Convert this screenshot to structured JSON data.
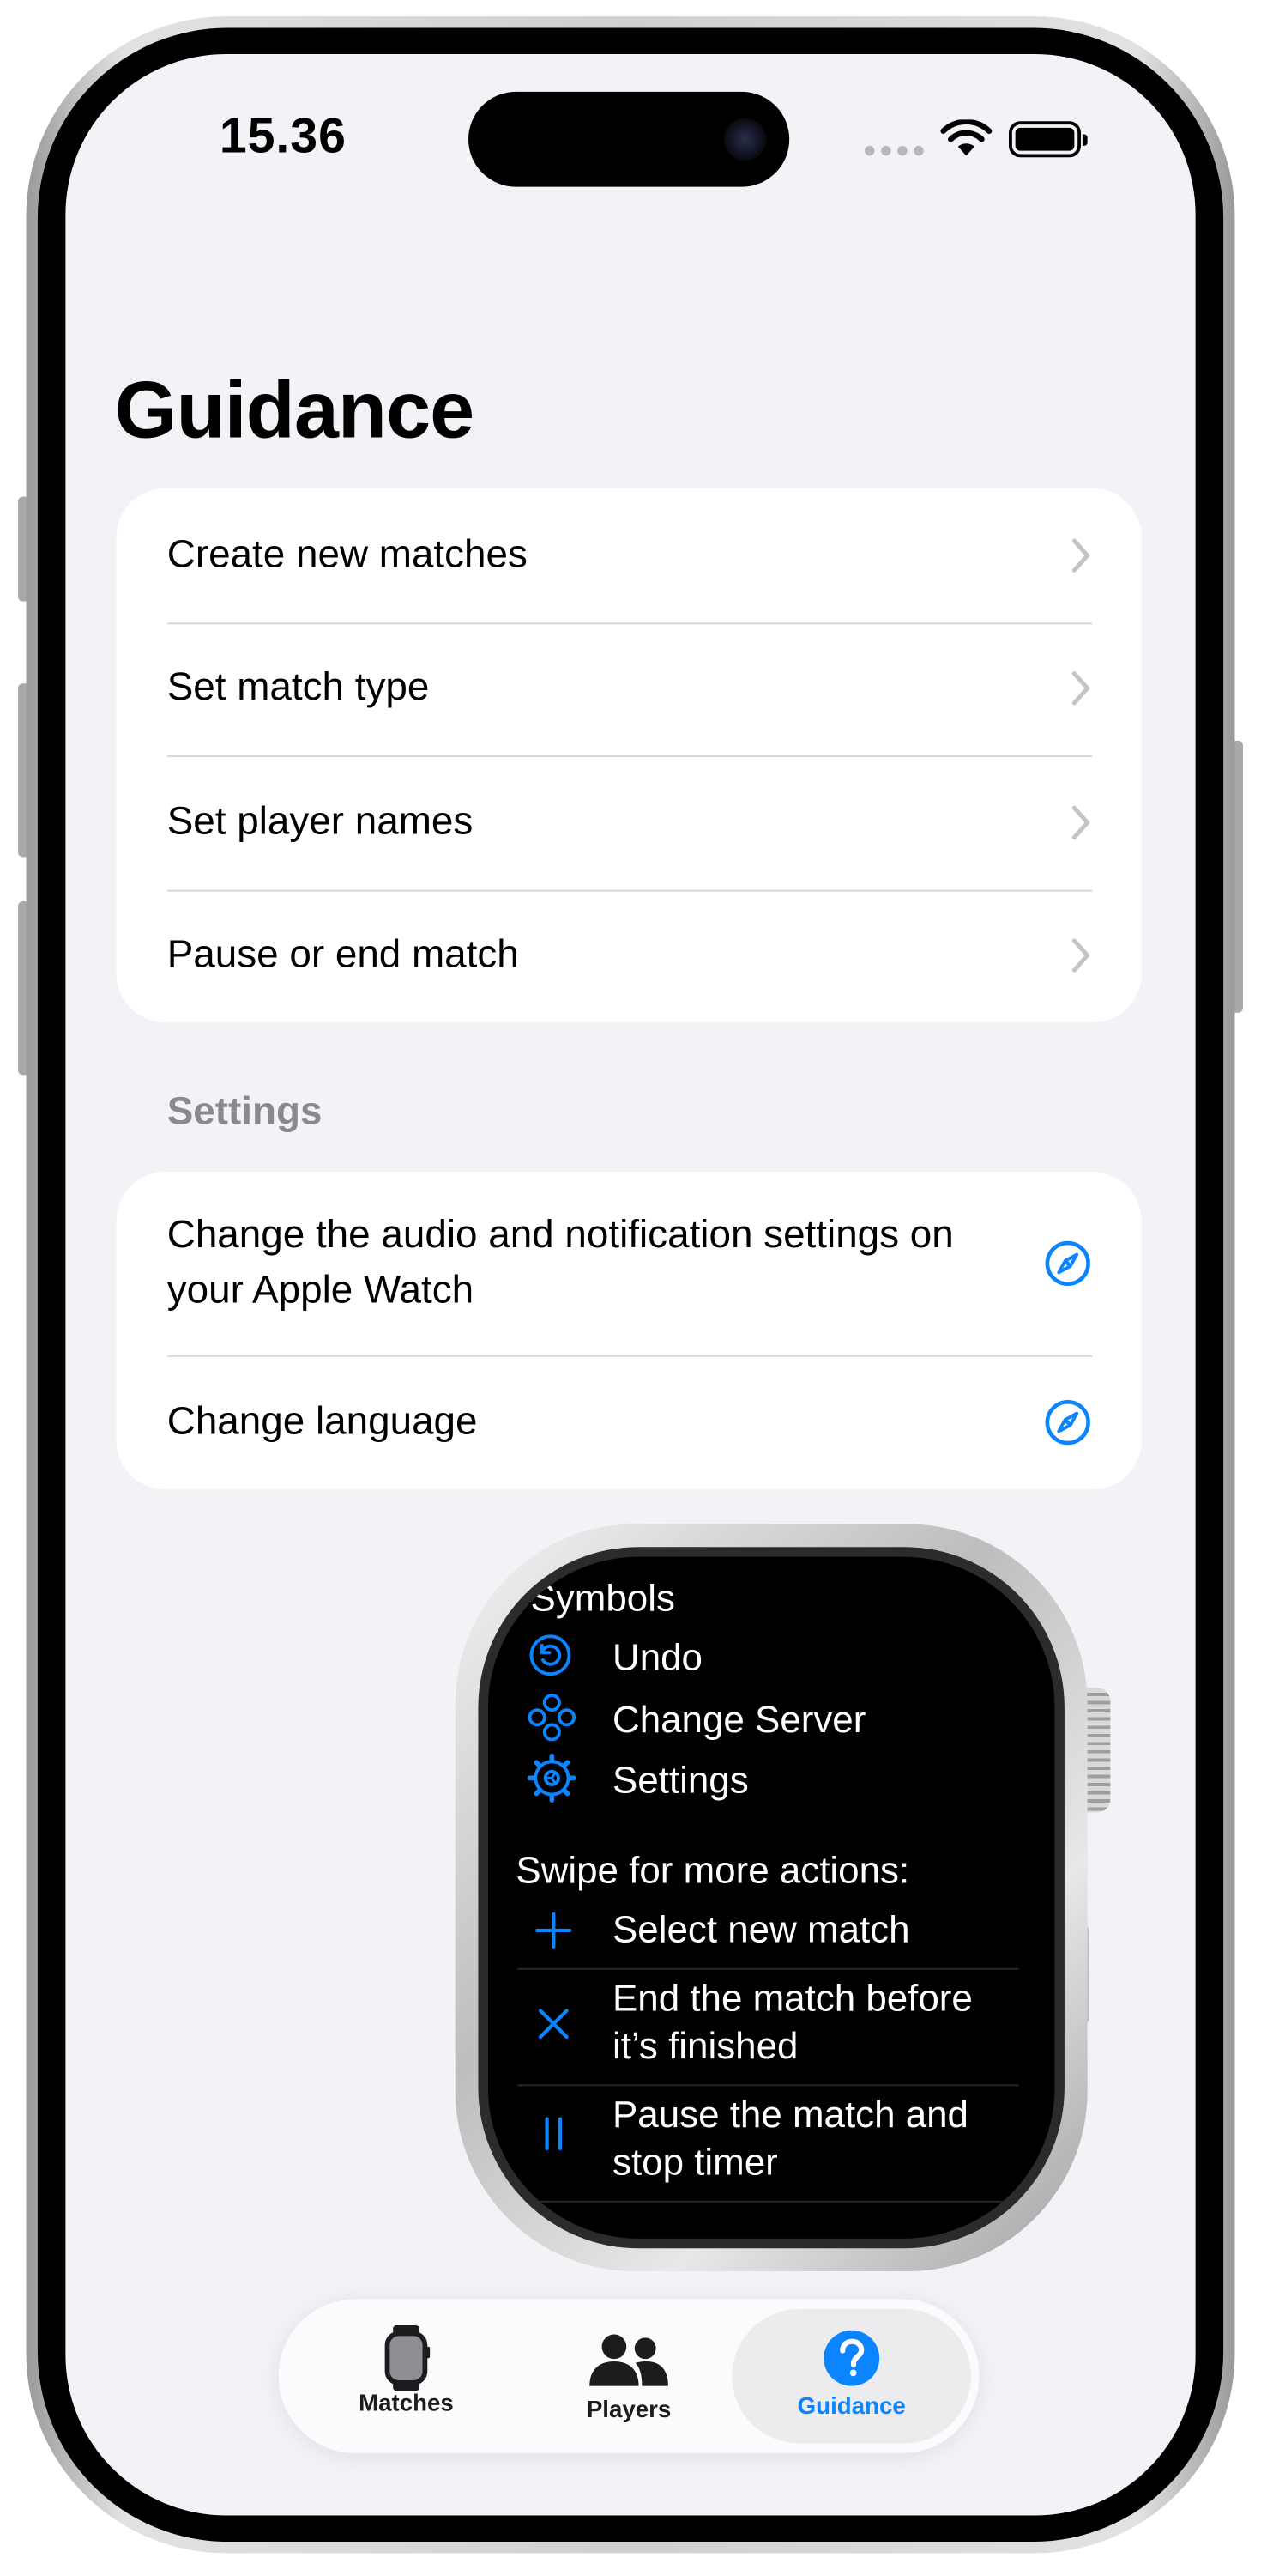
{
  "status_bar": {
    "time": "15.36"
  },
  "page": {
    "title": "Guidance"
  },
  "guidance_list": [
    {
      "label": "Create new matches"
    },
    {
      "label": "Set match type"
    },
    {
      "label": "Set player names"
    },
    {
      "label": "Pause or end match"
    }
  ],
  "settings": {
    "header": "Settings",
    "items": [
      {
        "label": "Change the audio and notification settings on your Apple Watch",
        "icon": "compass-icon"
      },
      {
        "label": "Change language",
        "icon": "compass-icon"
      }
    ]
  },
  "watch": {
    "symbols_title": "Symbols",
    "symbols": [
      {
        "label": "Undo",
        "icon": "undo-icon"
      },
      {
        "label": "Change Server",
        "icon": "change-server-icon"
      },
      {
        "label": "Settings",
        "icon": "settings-gear-icon"
      }
    ],
    "swipe_title": "Swipe for more actions:",
    "actions": [
      {
        "line1": "Select new match",
        "line2": "",
        "icon": "plus-icon"
      },
      {
        "line1": "End the match before",
        "line2": "it’s finished",
        "icon": "xmark-icon"
      },
      {
        "line1": "Pause the match and",
        "line2": "stop timer",
        "icon": "pause-icon"
      }
    ]
  },
  "tab_bar": {
    "tabs": [
      {
        "label": "Matches",
        "icon": "applewatch-icon"
      },
      {
        "label": "Players",
        "icon": "people-icon"
      },
      {
        "label": "Guidance",
        "icon": "question-circle-icon"
      }
    ],
    "selected": "Guidance"
  },
  "colors": {
    "accent": "#0a84ff",
    "background": "#f2f2f7",
    "card": "#ffffff",
    "secondary_text": "#8a8a8e"
  }
}
